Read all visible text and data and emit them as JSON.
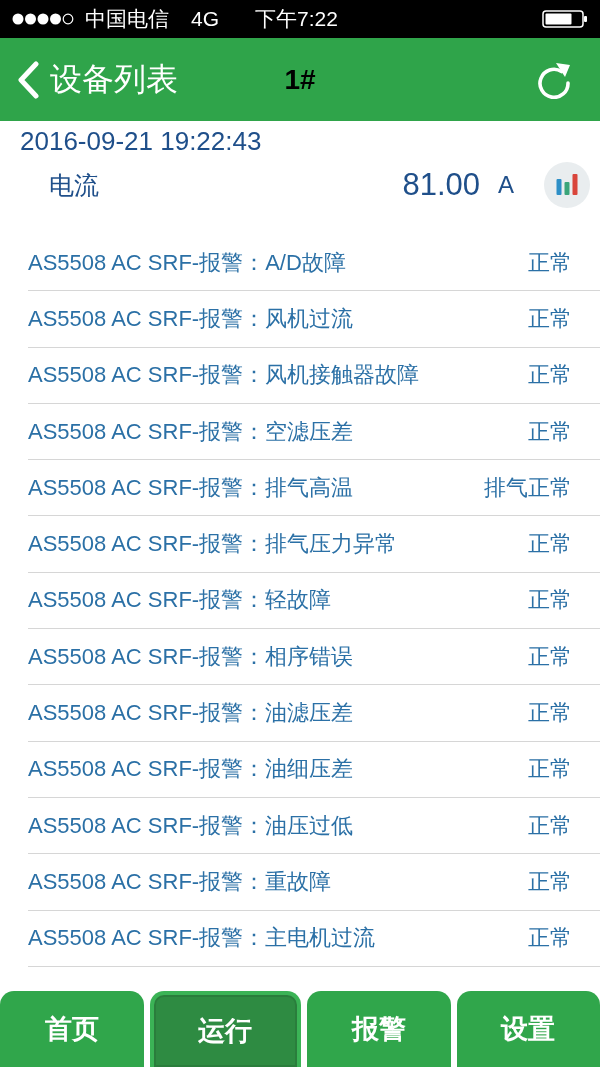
{
  "status_bar": {
    "carrier": "中国电信",
    "network": "4G",
    "time": "下午7:22"
  },
  "nav": {
    "back_label": "设备列表",
    "title": "1#"
  },
  "reading": {
    "timestamp": "2016-09-21 19:22:43",
    "name": "电流",
    "value": "81.00",
    "unit": "A"
  },
  "alarms": [
    {
      "name": "AS5508 AC SRF-报警：A/D故障",
      "status": "正常"
    },
    {
      "name": "AS5508 AC SRF-报警：风机过流",
      "status": "正常"
    },
    {
      "name": "AS5508 AC SRF-报警：风机接触器故障",
      "status": "正常"
    },
    {
      "name": "AS5508 AC SRF-报警：空滤压差",
      "status": "正常"
    },
    {
      "name": "AS5508 AC SRF-报警：排气高温",
      "status": "排气正常"
    },
    {
      "name": "AS5508 AC SRF-报警：排气压力异常",
      "status": "正常"
    },
    {
      "name": "AS5508 AC SRF-报警：轻故障",
      "status": "正常"
    },
    {
      "name": "AS5508 AC SRF-报警：相序错误",
      "status": "正常"
    },
    {
      "name": "AS5508 AC SRF-报警：油滤压差",
      "status": "正常"
    },
    {
      "name": "AS5508 AC SRF-报警：油细压差",
      "status": "正常"
    },
    {
      "name": "AS5508 AC SRF-报警：油压过低",
      "status": "正常"
    },
    {
      "name": "AS5508 AC SRF-报警：重故障",
      "status": "正常"
    },
    {
      "name": "AS5508 AC SRF-报警：主电机过流",
      "status": "正常"
    }
  ],
  "tabs": [
    {
      "label": "首页",
      "selected": false
    },
    {
      "label": "运行",
      "selected": true
    },
    {
      "label": "报警",
      "selected": false
    },
    {
      "label": "设置",
      "selected": false
    }
  ]
}
